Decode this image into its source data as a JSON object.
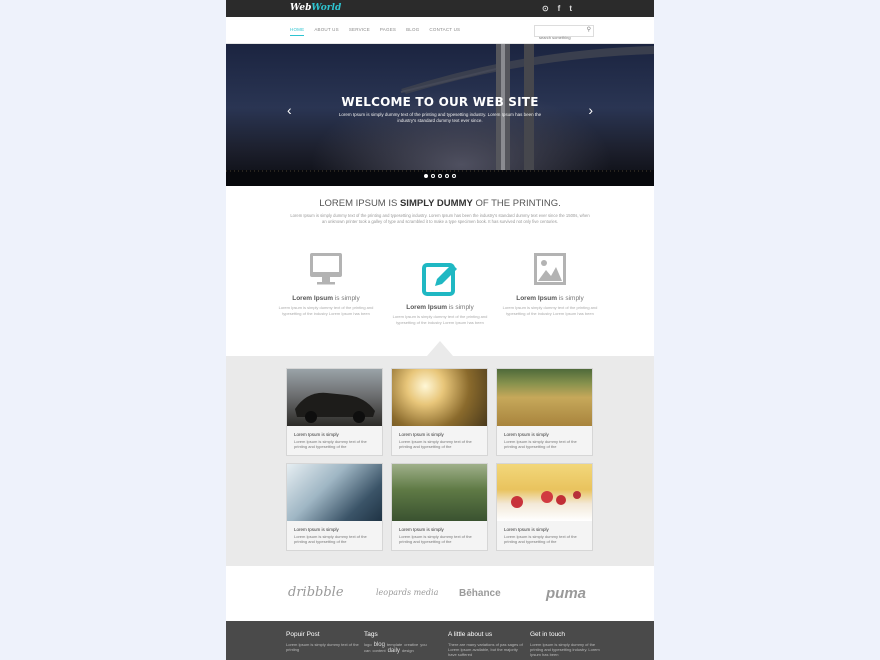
{
  "header": {
    "logo_part1": "Web",
    "logo_part2": "World",
    "social": [
      {
        "icon": "rss-icon",
        "glyph": "⊙"
      },
      {
        "icon": "facebook-icon",
        "glyph": "f"
      },
      {
        "icon": "twitter-icon",
        "glyph": "t"
      }
    ]
  },
  "nav": {
    "items": [
      "HOME",
      "ABOUT US",
      "SERVICE",
      "PAGES",
      "BLOG",
      "CONTACT US"
    ],
    "active_index": 0,
    "search_placeholder": "search something"
  },
  "hero": {
    "title": "WELCOME TO OUR WEB SITE",
    "text": "Lorem Ipsum is simply dummy text of the printing and typesetting industry. Lorem Ipsum has been the industry's standard dummy text ever since.",
    "prev_glyph": "‹",
    "next_glyph": "›",
    "slides": 5,
    "active_slide": 0
  },
  "intro": {
    "title_pre": "LOREM IPSUM IS ",
    "title_bold": "SIMPLY DUMMY",
    "title_post": " OF THE PRINTING.",
    "text": "Lorem Ipsum is simply dummy text of the printing and typesetting industry. Lorem Ipsum has been the industry's standard dummy text ever since the 1500s, when an unknown printer took a galley of type and scrambled it to make a type specimen book. It has survived not only five centuries."
  },
  "features": [
    {
      "icon": "monitor-icon",
      "title_bold": "Lorem Ipsum",
      "title_rest": " is simply",
      "text": "Lorem Ipsum is simply dummy text of the printing and typesetting of the industry Lorem Ipsum has been",
      "color": "#b3b3b3"
    },
    {
      "icon": "edit-icon",
      "title_bold": "Lorem Ipsum",
      "title_rest": " is simply",
      "text": "Lorem Ipsum is simply dummy text of the printing and typesetting of the industry Lorem Ipsum has been",
      "color": "#1fb8c3"
    },
    {
      "icon": "image-icon",
      "title_bold": "Lorem Ipsum",
      "title_rest": " is simply",
      "text": "Lorem Ipsum is simply dummy text of the printing and typesetting of the industry Lorem Ipsum has been",
      "color": "#b3b3b3"
    }
  ],
  "gallery": [
    {
      "image": "vintage-car",
      "title": "Lorem Ipsum is simply",
      "text": "Lorem Ipsum is simply dummy text of the printing and typesetting of the"
    },
    {
      "image": "sunlit-field",
      "title": "Lorem Ipsum is simply",
      "text": "Lorem Ipsum is simply dummy text of the printing and typesetting of the"
    },
    {
      "image": "wheat-field",
      "title": "Lorem Ipsum is simply",
      "text": "Lorem Ipsum is simply dummy text of the printing and typesetting of the"
    },
    {
      "image": "blurred-object",
      "title": "Lorem Ipsum is simply",
      "text": "Lorem Ipsum is simply dummy text of the printing and typesetting of the"
    },
    {
      "image": "green-wheat",
      "title": "Lorem Ipsum is simply",
      "text": "Lorem Ipsum is simply dummy text of the printing and typesetting of the"
    },
    {
      "image": "raspberries",
      "title": "Lorem Ipsum is simply",
      "text": "Lorem Ipsum is simply dummy text of the printing and typesetting of the"
    }
  ],
  "partners": [
    "dribbble",
    "leopards media",
    "Bēhance",
    "puma"
  ],
  "footer": {
    "popular": {
      "heading": "Popuir Post",
      "text": "Lorem Ipsum is simply dummy text of the printing"
    },
    "tags": {
      "heading": "Tags",
      "items": [
        "logo",
        "blog",
        "template",
        "creative",
        "you can",
        "content",
        "daily",
        "design"
      ]
    },
    "about": {
      "heading": "A little about us",
      "text": "There are many variations of pas sages of Lorem Ipsum available, but the majority have suffered"
    },
    "contact": {
      "heading": "Get in touch",
      "text": "Lorem Ipsum is simply dummy of the printing and typesetting industry. Lorem Ipsum has been"
    }
  },
  "colors": {
    "accent": "#2ec4d1",
    "topbar": "#2b2b2b",
    "footer": "#4a4a4a",
    "gallery_bg": "#eaeaea"
  }
}
